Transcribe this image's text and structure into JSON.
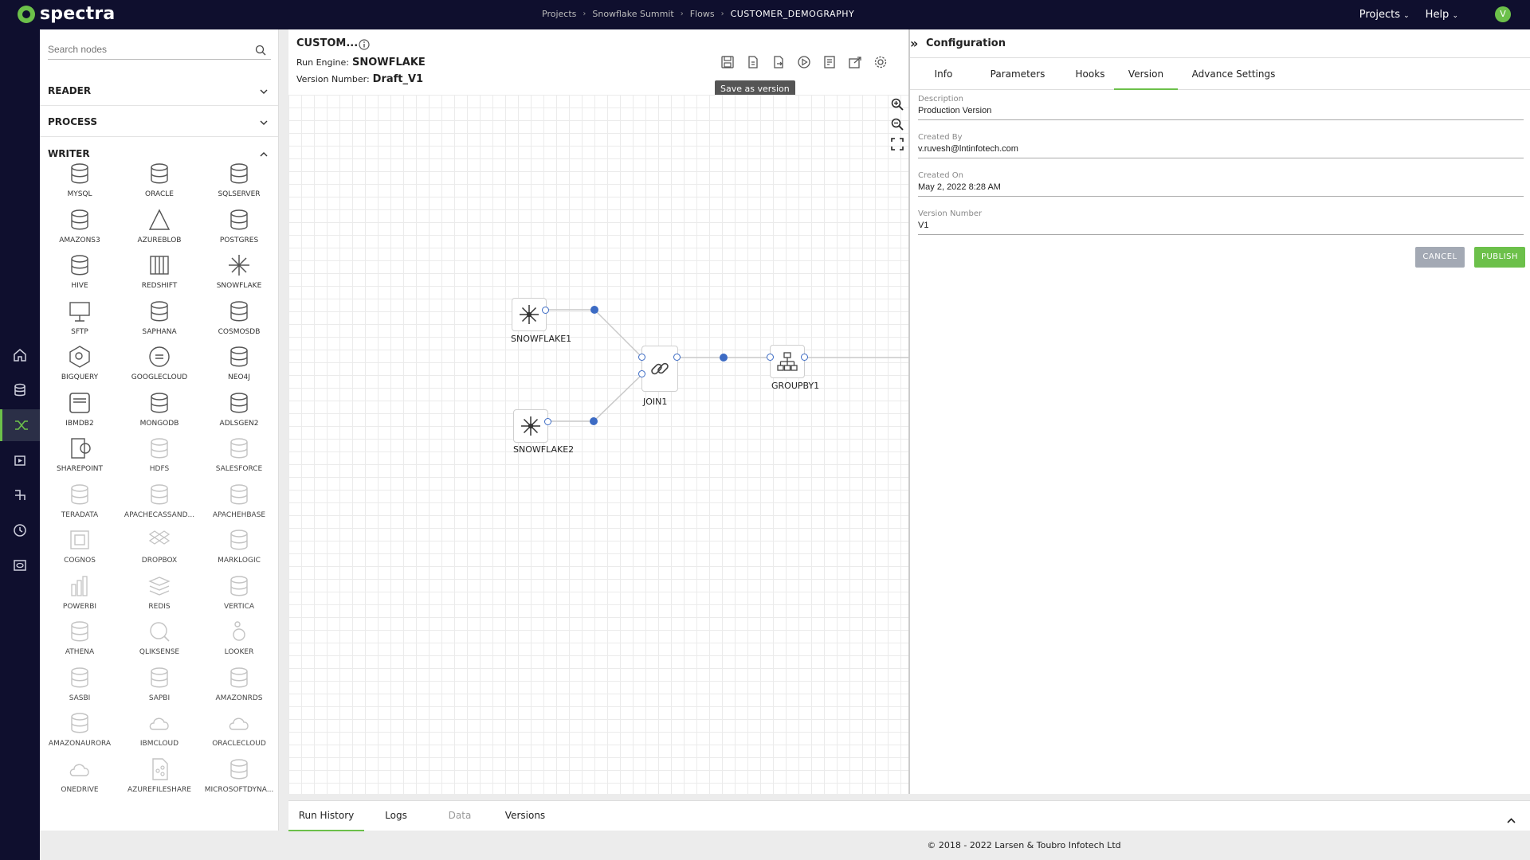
{
  "app": {
    "name": "spectra"
  },
  "breadcrumb": [
    "Projects",
    "Snowflake Summit",
    "Flows",
    "CUSTOMER_DEMOGRAPHY"
  ],
  "topmenu": {
    "projects": "Projects",
    "help": "Help",
    "avatar": "V"
  },
  "palette": {
    "search_placeholder": "Search nodes",
    "sections": {
      "reader": "READER",
      "process": "PROCESS",
      "writer": "WRITER"
    },
    "nodes": [
      {
        "label": "MYSQL",
        "icon": "mysql-icon",
        "dim": false
      },
      {
        "label": "ORACLE",
        "icon": "oracle-icon",
        "dim": false
      },
      {
        "label": "SQLSERVER",
        "icon": "sqlserver-icon",
        "dim": false
      },
      {
        "label": "AMAZONS3",
        "icon": "amazons3-icon",
        "dim": false
      },
      {
        "label": "AZUREBLOB",
        "icon": "azureblob-icon",
        "dim": false
      },
      {
        "label": "POSTGRES",
        "icon": "postgres-icon",
        "dim": false
      },
      {
        "label": "HIVE",
        "icon": "hive-icon",
        "dim": false
      },
      {
        "label": "REDSHIFT",
        "icon": "redshift-icon",
        "dim": false
      },
      {
        "label": "SNOWFLAKE",
        "icon": "snowflake-icon",
        "dim": false
      },
      {
        "label": "SFTP",
        "icon": "sftp-icon",
        "dim": false
      },
      {
        "label": "SAPHANA",
        "icon": "saphana-icon",
        "dim": false
      },
      {
        "label": "COSMOSDB",
        "icon": "cosmosdb-icon",
        "dim": false
      },
      {
        "label": "BIGQUERY",
        "icon": "bigquery-icon",
        "dim": false
      },
      {
        "label": "GOOGLECLOUD",
        "icon": "googlecloud-icon",
        "dim": false
      },
      {
        "label": "NEO4J",
        "icon": "neo4j-icon",
        "dim": false
      },
      {
        "label": "IBMDB2",
        "icon": "ibmdb2-icon",
        "dim": false
      },
      {
        "label": "MONGODB",
        "icon": "mongodb-icon",
        "dim": false
      },
      {
        "label": "ADLSGEN2",
        "icon": "adlsgen2-icon",
        "dim": false
      },
      {
        "label": "SHAREPOINT",
        "icon": "sharepoint-icon",
        "dim": false
      },
      {
        "label": "HDFS",
        "icon": "hdfs-icon",
        "dim": true
      },
      {
        "label": "SALESFORCE",
        "icon": "salesforce-icon",
        "dim": true
      },
      {
        "label": "TERADATA",
        "icon": "teradata-icon",
        "dim": true
      },
      {
        "label": "APACHECASSAND...",
        "icon": "cassandra-icon",
        "dim": true
      },
      {
        "label": "APACHEHBASE",
        "icon": "hbase-icon",
        "dim": true
      },
      {
        "label": "COGNOS",
        "icon": "cognos-icon",
        "dim": true
      },
      {
        "label": "DROPBOX",
        "icon": "dropbox-icon",
        "dim": true
      },
      {
        "label": "MARKLOGIC",
        "icon": "marklogic-icon",
        "dim": true
      },
      {
        "label": "POWERBI",
        "icon": "powerbi-icon",
        "dim": true
      },
      {
        "label": "REDIS",
        "icon": "redis-icon",
        "dim": true
      },
      {
        "label": "VERTICA",
        "icon": "vertica-icon",
        "dim": true
      },
      {
        "label": "ATHENA",
        "icon": "athena-icon",
        "dim": true
      },
      {
        "label": "QLIKSENSE",
        "icon": "qliksense-icon",
        "dim": true
      },
      {
        "label": "LOOKER",
        "icon": "looker-icon",
        "dim": true
      },
      {
        "label": "SASBI",
        "icon": "sasbi-icon",
        "dim": true
      },
      {
        "label": "SAPBI",
        "icon": "sapbi-icon",
        "dim": true
      },
      {
        "label": "AMAZONRDS",
        "icon": "amazonrds-icon",
        "dim": true
      },
      {
        "label": "AMAZONAURORA",
        "icon": "amazonaurora-icon",
        "dim": true
      },
      {
        "label": "IBMCLOUD",
        "icon": "ibmcloud-icon",
        "dim": true
      },
      {
        "label": "ORACLECLOUD",
        "icon": "oraclecloud-icon",
        "dim": true
      },
      {
        "label": "ONEDRIVE",
        "icon": "onedrive-icon",
        "dim": true
      },
      {
        "label": "AZUREFILESHARE",
        "icon": "azurefileshare-icon",
        "dim": true
      },
      {
        "label": "MICROSOFTDYNA...",
        "icon": "msdynamics-icon",
        "dim": true
      }
    ]
  },
  "flow": {
    "title": "CUSTOM...",
    "run_engine_label": "Run Engine:",
    "run_engine": "SNOWFLAKE",
    "version_label": "Version Number:",
    "version": "Draft_V1",
    "tooltip": "Save as version",
    "nodes": {
      "snowflake1": "SNOWFLAKE1",
      "snowflake2": "SNOWFLAKE2",
      "join": "JOIN1",
      "groupby": "GROUPBY1"
    }
  },
  "config": {
    "title": "Configuration",
    "tabs": [
      "Info",
      "Parameters",
      "Hooks",
      "Version",
      "Advance Settings"
    ],
    "active_tab": "Version",
    "fields": {
      "description_label": "Description",
      "description": "Production Version",
      "created_by_label": "Created By",
      "created_by": "v.ruvesh@lntinfotech.com",
      "created_on_label": "Created On",
      "created_on": "May 2, 2022 8:28 AM",
      "version_number_label": "Version Number",
      "version_number": "V1"
    },
    "cancel": "CANCEL",
    "publish": "PUBLISH"
  },
  "bottom_tabs": [
    "Run History",
    "Logs",
    "Data",
    "Versions"
  ],
  "footer": "© 2018 - 2022 Larsen & Toubro Infotech Ltd",
  "colors": {
    "accent": "#6cc04a",
    "nav": "#0f0f2e",
    "port": "#3c6bc4",
    "cancel": "#a3a9b4"
  }
}
